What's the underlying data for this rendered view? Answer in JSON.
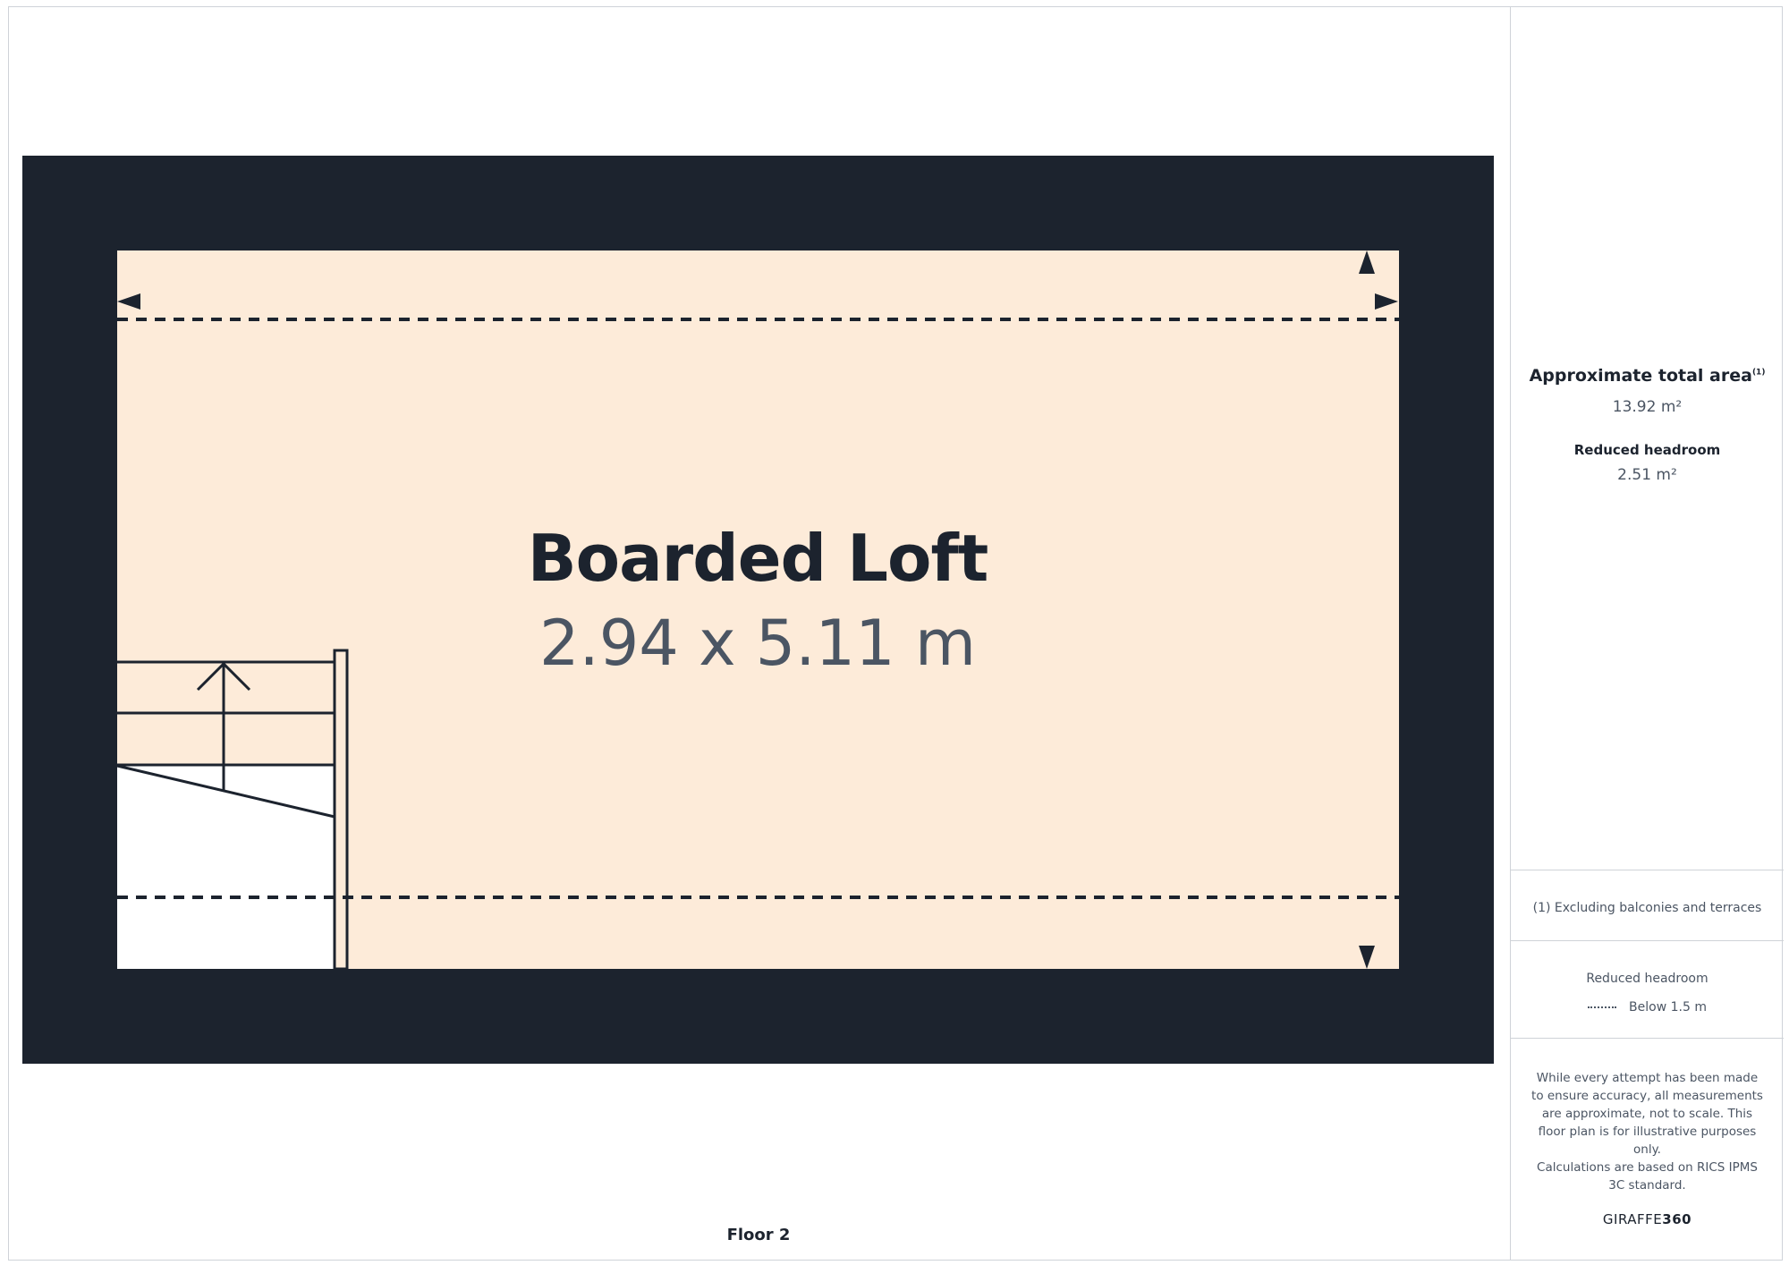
{
  "colors": {
    "wall": "#1c232e",
    "floor": "#fdebd9",
    "text_secondary": "#4b5563",
    "divider": "#cfd3d8"
  },
  "room": {
    "name": "Boarded Loft",
    "dimensions": "2.94 x 5.11 m"
  },
  "floor_label": "Floor 2",
  "panel": {
    "area_title": "Approximate total area",
    "area_title_note": "(1)",
    "area_value": "13.92 m²",
    "headroom_title": "Reduced headroom",
    "headroom_value": "2.51 m²",
    "footnote": "(1) Excluding balconies and terraces",
    "legend_title": "Reduced headroom",
    "legend_item": "Below 1.5 m",
    "disclaimer": "While every attempt has been made to ensure accuracy, all measurements are approximate, not to scale. This floor plan is for illustrative purposes only.",
    "calculations": "Calculations are based on RICS IPMS 3C standard.",
    "brand_light": "GIRAFFE",
    "brand_bold": "360"
  }
}
